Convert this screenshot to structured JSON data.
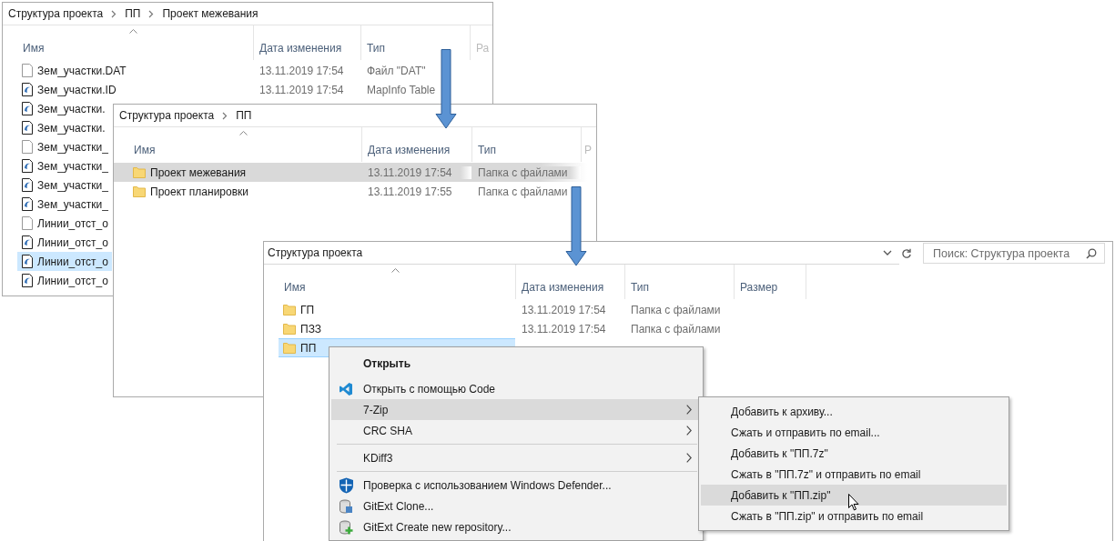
{
  "windows": [
    {
      "breadcrumb": [
        "Структура проекта",
        "ПП",
        "Проект межевания"
      ],
      "columns": [
        "Имя",
        "Дата изменения",
        "Тип",
        "Ра"
      ],
      "rows": [
        {
          "kind": "file",
          "name": "Зем_участки.DAT",
          "date": "13.11.2019 17:54",
          "type": "Файл \"DAT\"",
          "selected": false
        },
        {
          "kind": "mapinfo",
          "name": "Зем_участки.ID",
          "date": "13.11.2019 17:54",
          "type": "MapInfo Table",
          "selected": false
        },
        {
          "kind": "mapinfo",
          "name": "Зем_участки.",
          "selected": false
        },
        {
          "kind": "mapinfo",
          "name": "Зем_участки.",
          "selected": false
        },
        {
          "kind": "file",
          "name": "Зем_участки_",
          "selected": false
        },
        {
          "kind": "mapinfo",
          "name": "Зем_участки_",
          "selected": false
        },
        {
          "kind": "mapinfo",
          "name": "Зем_участки_",
          "selected": false
        },
        {
          "kind": "mapinfo",
          "name": "Зем_участки_",
          "selected": false
        },
        {
          "kind": "file",
          "name": "Линии_отст_о",
          "selected": false
        },
        {
          "kind": "mapinfo",
          "name": "Линии_отст_о",
          "selected": false
        },
        {
          "kind": "mapinfo",
          "name": "Линии_отст_о",
          "selected": true
        },
        {
          "kind": "mapinfo",
          "name": "Линии_отст_о",
          "selected": false
        }
      ]
    },
    {
      "breadcrumb": [
        "Структура проекта",
        "ПП"
      ],
      "columns": [
        "Имя",
        "Дата изменения",
        "Тип",
        "Р"
      ],
      "rows": [
        {
          "kind": "folder",
          "name": "Проект межевания",
          "date": "13.11.2019 17:54",
          "type": "Папка с файлами",
          "selected": true
        },
        {
          "kind": "folder",
          "name": "Проект планировки",
          "date": "13.11.2019 17:55",
          "type": "Папка с файлами",
          "selected": false
        }
      ]
    },
    {
      "address": "Структура проекта",
      "search": {
        "placeholder": "Поиск: Структура проекта"
      },
      "columns": [
        "Имя",
        "Дата изменения",
        "Тип",
        "Размер"
      ],
      "rows": [
        {
          "kind": "folder",
          "name": "ГП",
          "date": "13.11.2019 17:54",
          "type": "Папка с файлами",
          "selected": false
        },
        {
          "kind": "folder",
          "name": "ПЗЗ",
          "date": "13.11.2019 17:54",
          "type": "Папка с файлами",
          "selected": false
        },
        {
          "kind": "folder",
          "name": "ПП",
          "selected": true
        }
      ]
    }
  ],
  "context_menu": {
    "items": [
      {
        "kind": "plain",
        "label": "Открыть",
        "default": true,
        "submenu": false,
        "selected": false
      },
      {
        "kind": "code",
        "label": "Открыть с помощью Code",
        "default": false,
        "submenu": false,
        "selected": false
      },
      {
        "kind": "plain",
        "label": "7-Zip",
        "default": false,
        "submenu": true,
        "selected": true
      },
      {
        "kind": "plain",
        "label": "CRC SHA",
        "default": false,
        "submenu": true,
        "selected": false
      },
      {
        "kind": "separator"
      },
      {
        "kind": "plain",
        "label": "KDiff3",
        "default": false,
        "submenu": true,
        "selected": false
      },
      {
        "kind": "separator"
      },
      {
        "kind": "shield",
        "label": "Проверка с использованием Windows Defender...",
        "default": false,
        "submenu": false,
        "selected": false
      },
      {
        "kind": "database",
        "label": "GitExt Clone...",
        "default": false,
        "submenu": false,
        "selected": false
      },
      {
        "kind": "database-add",
        "label": "GitExt Create new repository...",
        "default": false,
        "submenu": false,
        "selected": false
      }
    ]
  },
  "submenu": {
    "items": [
      {
        "label": "Добавить к архиву...",
        "selected": false
      },
      {
        "label": "Сжать и отправить по email...",
        "selected": false
      },
      {
        "label": "Добавить к \"ПП.7z\"",
        "selected": false
      },
      {
        "label": "Сжать в \"ПП.7z\" и отправить по email",
        "selected": false
      },
      {
        "label": "Добавить к \"ПП.zip\"",
        "selected": true
      },
      {
        "label": "Сжать в \"ПП.zip\" и отправить по email",
        "selected": false
      }
    ]
  }
}
